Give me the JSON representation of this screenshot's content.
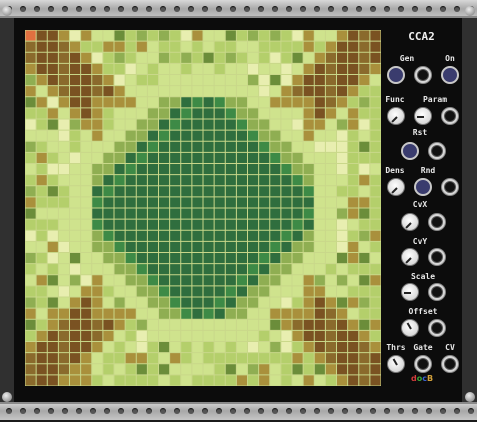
{
  "module": {
    "title": "CCA2",
    "brand_letters": [
      "d",
      "o",
      "c",
      "B"
    ],
    "brand_colors": [
      "#d23b3b",
      "#3aa63a",
      "#3b62d2",
      "#d2a03b"
    ]
  },
  "labels": {
    "gen": "Gen",
    "on": "On",
    "func": "Func",
    "param": "Param",
    "rst": "Rst",
    "dens": "Dens",
    "rnd": "Rnd",
    "cvx": "CvX",
    "cvy": "CvY",
    "scale": "Scale",
    "offset": "Offset",
    "thrs": "Thrs",
    "gate": "Gate",
    "cv": "CV"
  },
  "controls": {
    "gen_button": "blue-button",
    "on_button": "blue-button",
    "rst_button": "blue-button",
    "rnd_button": "blue-button",
    "func_knob": "white-knob",
    "param_knob": "white-knob",
    "dens_knob": "white-knob",
    "cvx_knob": "white-knob",
    "cvy_knob": "white-knob",
    "scale_knob": "white-knob",
    "offset_knob": "white-knob",
    "thrs_knob": "white-knob"
  },
  "grid": {
    "size": 32,
    "highlight_color": "#e07040",
    "palette": [
      "#2f6e3e",
      "#3d8a46",
      "#6b8d3a",
      "#8fae52",
      "#b4cf6b",
      "#cfe38d",
      "#e8eeb0",
      "#a9903c",
      "#8a6a2c",
      "#7a5222"
    ]
  }
}
